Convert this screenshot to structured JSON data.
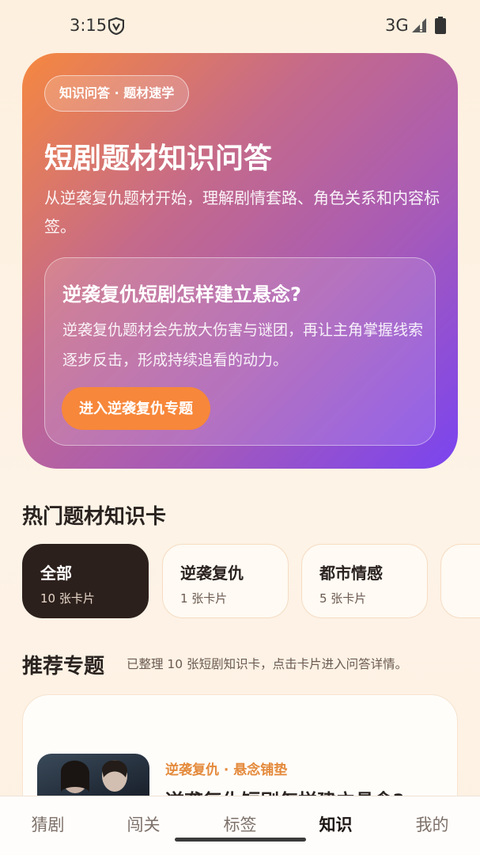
{
  "status_bar": {
    "time": "3:15",
    "network": "3G",
    "icons": [
      "shield-icon",
      "signal-icon",
      "battery-icon"
    ]
  },
  "hero": {
    "chip": "知识问答 · 题材速学",
    "title": "短剧题材知识问答",
    "subtitle": "从逆袭复仇题材开始，理解剧情套路、角色关系和内容标签。",
    "question": {
      "title": "逆袭复仇短剧怎样建立悬念?",
      "description": "逆袭复仇题材会先放大伤害与谜团，再让主角掌握线索逐步反击，形成持续追看的动力。",
      "button": "进入逆袭复仇专题"
    },
    "gradient": [
      "#f6883f",
      "#c56a8a",
      "#a85bb6",
      "#7a44f0"
    ]
  },
  "hot_topics": {
    "title": "热门题材知识卡",
    "categories": [
      {
        "name": "全部",
        "count": "10 张卡片",
        "active": true
      },
      {
        "name": "逆袭复仇",
        "count": "1 张卡片",
        "active": false
      },
      {
        "name": "都市情感",
        "count": "5 张卡片",
        "active": false
      }
    ]
  },
  "recommended": {
    "title": "推荐专题",
    "note": "已整理 10 张短剧知识卡，点击卡片进入问答详情。",
    "card": {
      "tag": "逆袭复仇 · 悬念铺垫",
      "title": "逆袭复仇短剧怎样建立悬念?"
    }
  },
  "bottom_nav": {
    "items": [
      {
        "label": "猜剧",
        "active": false
      },
      {
        "label": "闯关",
        "active": false
      },
      {
        "label": "标签",
        "active": false
      },
      {
        "label": "知识",
        "active": true
      },
      {
        "label": "我的",
        "active": false
      }
    ]
  },
  "colors": {
    "accent": "#f7873a",
    "dark": "#2c201c",
    "tag": "#e48a3c"
  }
}
